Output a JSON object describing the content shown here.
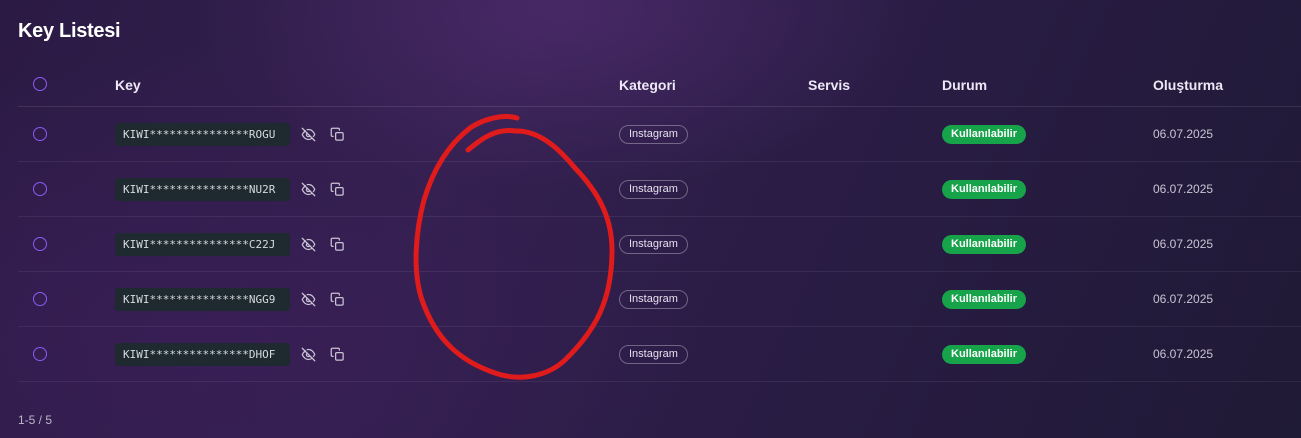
{
  "page": {
    "title": "Key Listesi"
  },
  "table": {
    "columns": {
      "key": "Key",
      "category": "Kategori",
      "service": "Servis",
      "status": "Durum",
      "created": "Oluşturma"
    },
    "rows": [
      {
        "key": "KIWI***************ROGU",
        "category": "Instagram",
        "service": "",
        "status": "Kullanılabilir",
        "created": "06.07.2025"
      },
      {
        "key": "KIWI***************NU2R",
        "category": "Instagram",
        "service": "",
        "status": "Kullanılabilir",
        "created": "06.07.2025"
      },
      {
        "key": "KIWI***************C22J",
        "category": "Instagram",
        "service": "",
        "status": "Kullanılabilir",
        "created": "06.07.2025"
      },
      {
        "key": "KIWI***************NGG9",
        "category": "Instagram",
        "service": "",
        "status": "Kullanılabilir",
        "created": "06.07.2025"
      },
      {
        "key": "KIWI***************DHOF",
        "category": "Instagram",
        "service": "",
        "status": "Kullanılabilir",
        "created": "06.07.2025"
      }
    ]
  },
  "pagination": {
    "text": "1-5 / 5"
  },
  "icons": {
    "reveal": "eye-off-icon",
    "copy": "copy-icon"
  },
  "colors": {
    "accent": "#8b5cf6",
    "status_available": "#16a34a",
    "annotation": "#e01b1b"
  }
}
